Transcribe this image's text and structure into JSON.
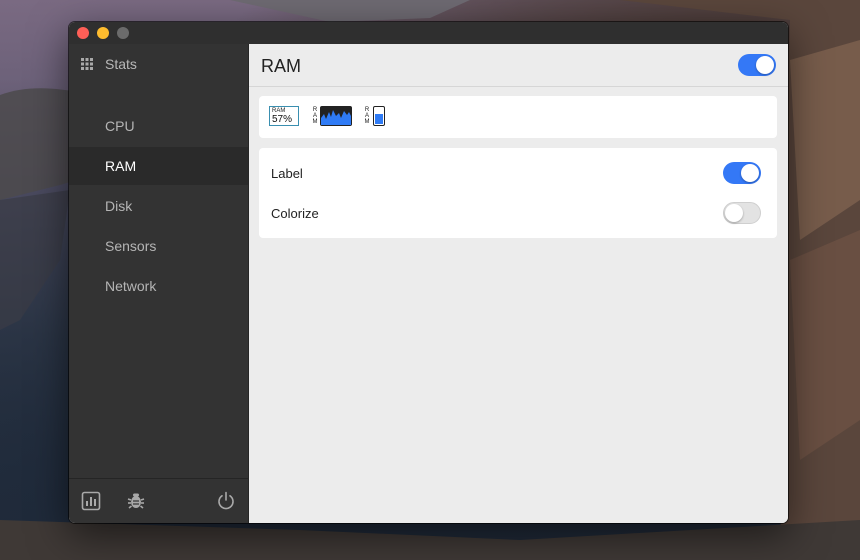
{
  "sidebar": {
    "app_title": "Stats",
    "items": [
      {
        "label": "CPU"
      },
      {
        "label": "RAM"
      },
      {
        "label": "Disk"
      },
      {
        "label": "Sensors"
      },
      {
        "label": "Network"
      }
    ],
    "active_index": 1,
    "footer_icons": [
      "dashboard-icon",
      "bug-report-icon",
      "power-icon"
    ]
  },
  "main": {
    "title": "RAM",
    "module_enabled": true,
    "widgets": {
      "mini": {
        "label": "RAM",
        "value": "57%"
      },
      "line_chart": {
        "label_letters": [
          "R",
          "A",
          "M"
        ]
      },
      "bar_chart": {
        "label_letters": [
          "R",
          "A",
          "M"
        ],
        "fill": 0.6
      }
    },
    "settings": [
      {
        "label": "Label",
        "enabled": true
      },
      {
        "label": "Colorize",
        "enabled": false
      }
    ]
  },
  "colors": {
    "accent": "#3478f6",
    "sidebar_bg": "#333333",
    "content_bg": "#ececec"
  }
}
